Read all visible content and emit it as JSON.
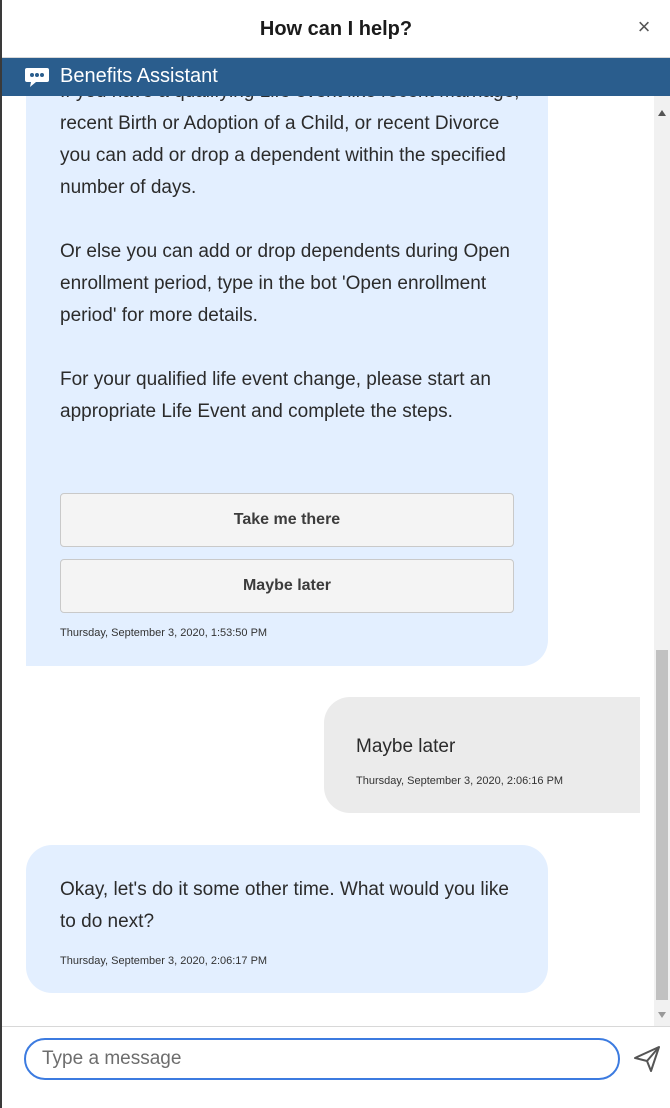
{
  "window": {
    "title": "How can I help?",
    "close_label": "×"
  },
  "header": {
    "assistant_name": "Benefits Assistant"
  },
  "messages": [
    {
      "sender": "bot",
      "paragraphs": [
        "If you have a qualifying Life event like recent Marriage, recent Birth or Adoption of a Child, or recent Divorce you can add or drop a dependent within the specified number of days.",
        "Or else you can add or drop dependents during Open enrollment period, type in the bot 'Open enrollment period' for more details.",
        "For your qualified life event change, please start an appropriate Life Event and complete the steps."
      ],
      "buttons": [
        "Take me there",
        "Maybe later"
      ],
      "timestamp": "Thursday, September 3, 2020, 1:53:50 PM"
    },
    {
      "sender": "user",
      "text": "Maybe later",
      "timestamp": "Thursday, September 3, 2020, 2:06:16 PM"
    },
    {
      "sender": "bot",
      "text": "Okay, let's do it some other time. What would you like to do next?",
      "timestamp": "Thursday, September 3, 2020, 2:06:17 PM"
    }
  ],
  "composer": {
    "placeholder": "Type a message"
  },
  "colors": {
    "header_bg": "#2a5d8d",
    "bot_bubble": "#e3efff",
    "user_bubble": "#ebebeb",
    "input_border": "#3c7be0"
  },
  "icons": {
    "header": "chat-bubble-icon",
    "send": "send-icon",
    "close": "close-icon"
  }
}
